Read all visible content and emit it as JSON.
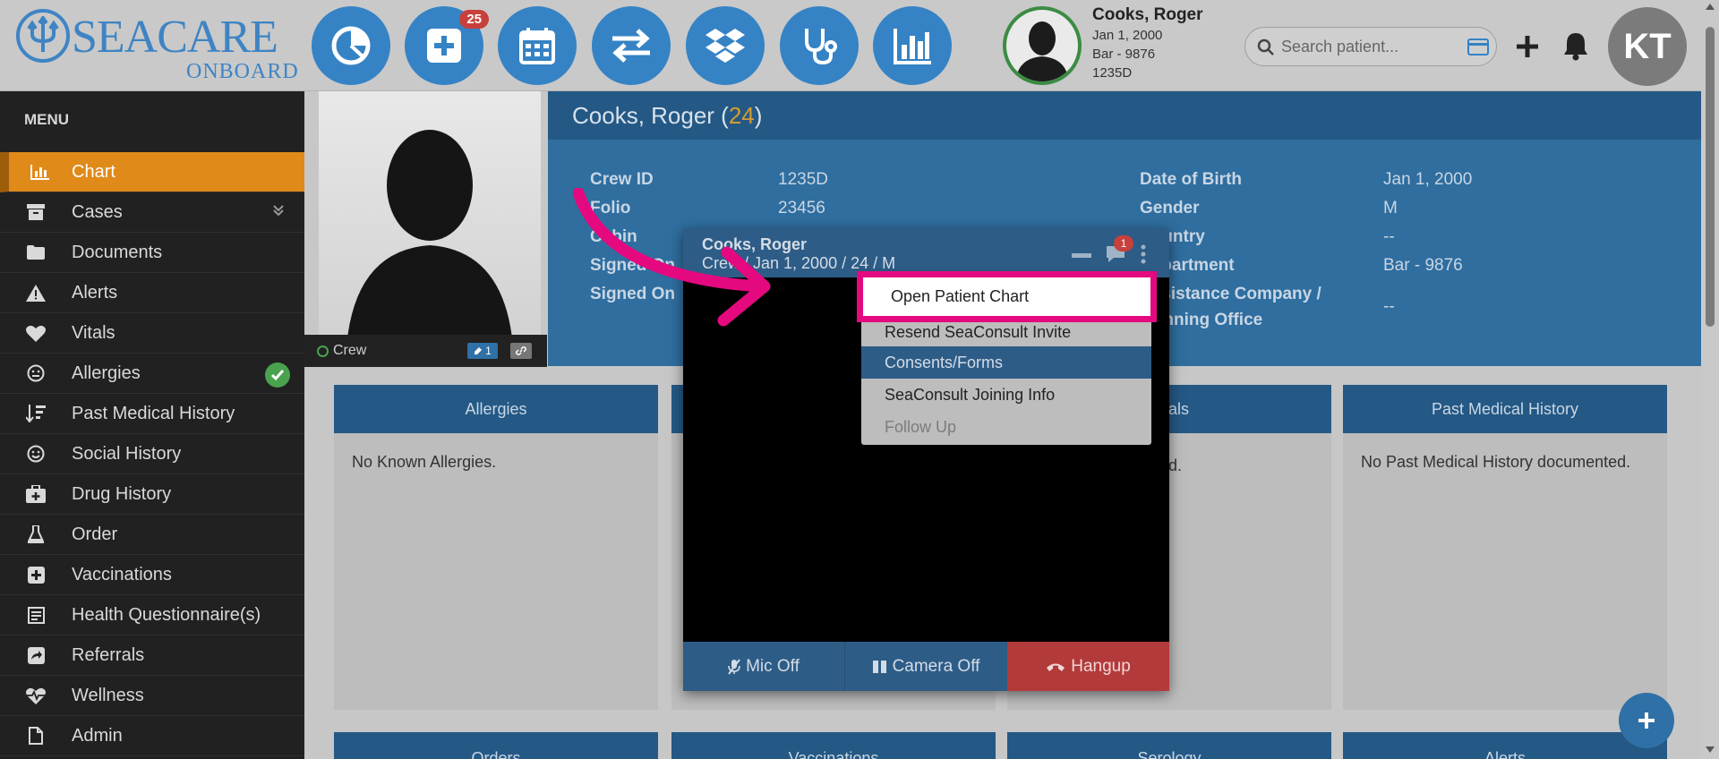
{
  "header": {
    "brand_main": "SEACARE",
    "brand_sub": "ONBOARD",
    "nav_badge": "25",
    "patient": {
      "name": "Cooks, Roger",
      "dob": "Jan 1, 2000",
      "department": "Bar - 9876",
      "crew_id": "1235D"
    },
    "search_placeholder": "Search patient...",
    "user_initials": "KT"
  },
  "sidebar": {
    "title": "MENU",
    "items": [
      {
        "label": "Chart",
        "icon": "bar-chart-icon"
      },
      {
        "label": "Cases",
        "icon": "archive-icon"
      },
      {
        "label": "Documents",
        "icon": "folder-icon"
      },
      {
        "label": "Alerts",
        "icon": "warning-icon"
      },
      {
        "label": "Vitals",
        "icon": "heart-icon"
      },
      {
        "label": "Allergies",
        "icon": "face-icon"
      },
      {
        "label": "Past Medical History",
        "icon": "sort-icon"
      },
      {
        "label": "Social History",
        "icon": "smile-icon"
      },
      {
        "label": "Drug History",
        "icon": "medkit-icon"
      },
      {
        "label": "Order",
        "icon": "flask-icon"
      },
      {
        "label": "Vaccinations",
        "icon": "plus-square-icon"
      },
      {
        "label": "Health Questionnaire(s)",
        "icon": "form-icon"
      },
      {
        "label": "Referrals",
        "icon": "share-icon"
      },
      {
        "label": "Wellness",
        "icon": "heartbeat-icon"
      },
      {
        "label": "Admin",
        "icon": "file-icon"
      }
    ]
  },
  "photo": {
    "status": "Crew",
    "chip_count": "1"
  },
  "info": {
    "title_name": "Cooks, Roger (",
    "title_age": "24",
    "title_close": ")",
    "left": [
      {
        "label": "Crew ID",
        "value": "1235D"
      },
      {
        "label": "Folio",
        "value": "23456"
      },
      {
        "label": "Cabin",
        "value": ""
      },
      {
        "label": "Signed On",
        "value": ""
      },
      {
        "label": "Signed On",
        "value": ""
      }
    ],
    "right": [
      {
        "label": "Date of Birth",
        "value": "Jan 1, 2000"
      },
      {
        "label": "Gender",
        "value": "M"
      },
      {
        "label": "Country",
        "value": "--"
      },
      {
        "label": "Department",
        "value": "Bar - 9876"
      },
      {
        "label": "Assistance Company /",
        "label2": "Manning Office",
        "value": "--"
      }
    ]
  },
  "cards": [
    {
      "title": "Allergies",
      "body": "No Known Allergies."
    },
    {
      "title": "",
      "body": ""
    },
    {
      "title": "als",
      "body": "d."
    },
    {
      "title": "Past Medical History",
      "body": "No Past Medical History documented."
    }
  ],
  "cards_bottom": [
    "Orders",
    "Vaccinations",
    "Serology",
    "Alerts"
  ],
  "call": {
    "name": "Cooks, Roger",
    "subtitle": "Crew / Jan 1, 2000 / 24 / M",
    "chat_badge": "1",
    "mic_label": "Mic Off",
    "camera_label": "Camera Off",
    "hangup_label": "Hangup"
  },
  "context_menu": {
    "items": [
      "Open Patient Chart",
      "Resend SeaConsult Invite",
      "Consents/Forms",
      "SeaConsult Joining Info",
      "Follow Up"
    ]
  },
  "colors": {
    "accent": "#3583c5",
    "active_menu": "#e08a1a",
    "highlight": "#e5097f",
    "hangup": "#b33a3a"
  }
}
